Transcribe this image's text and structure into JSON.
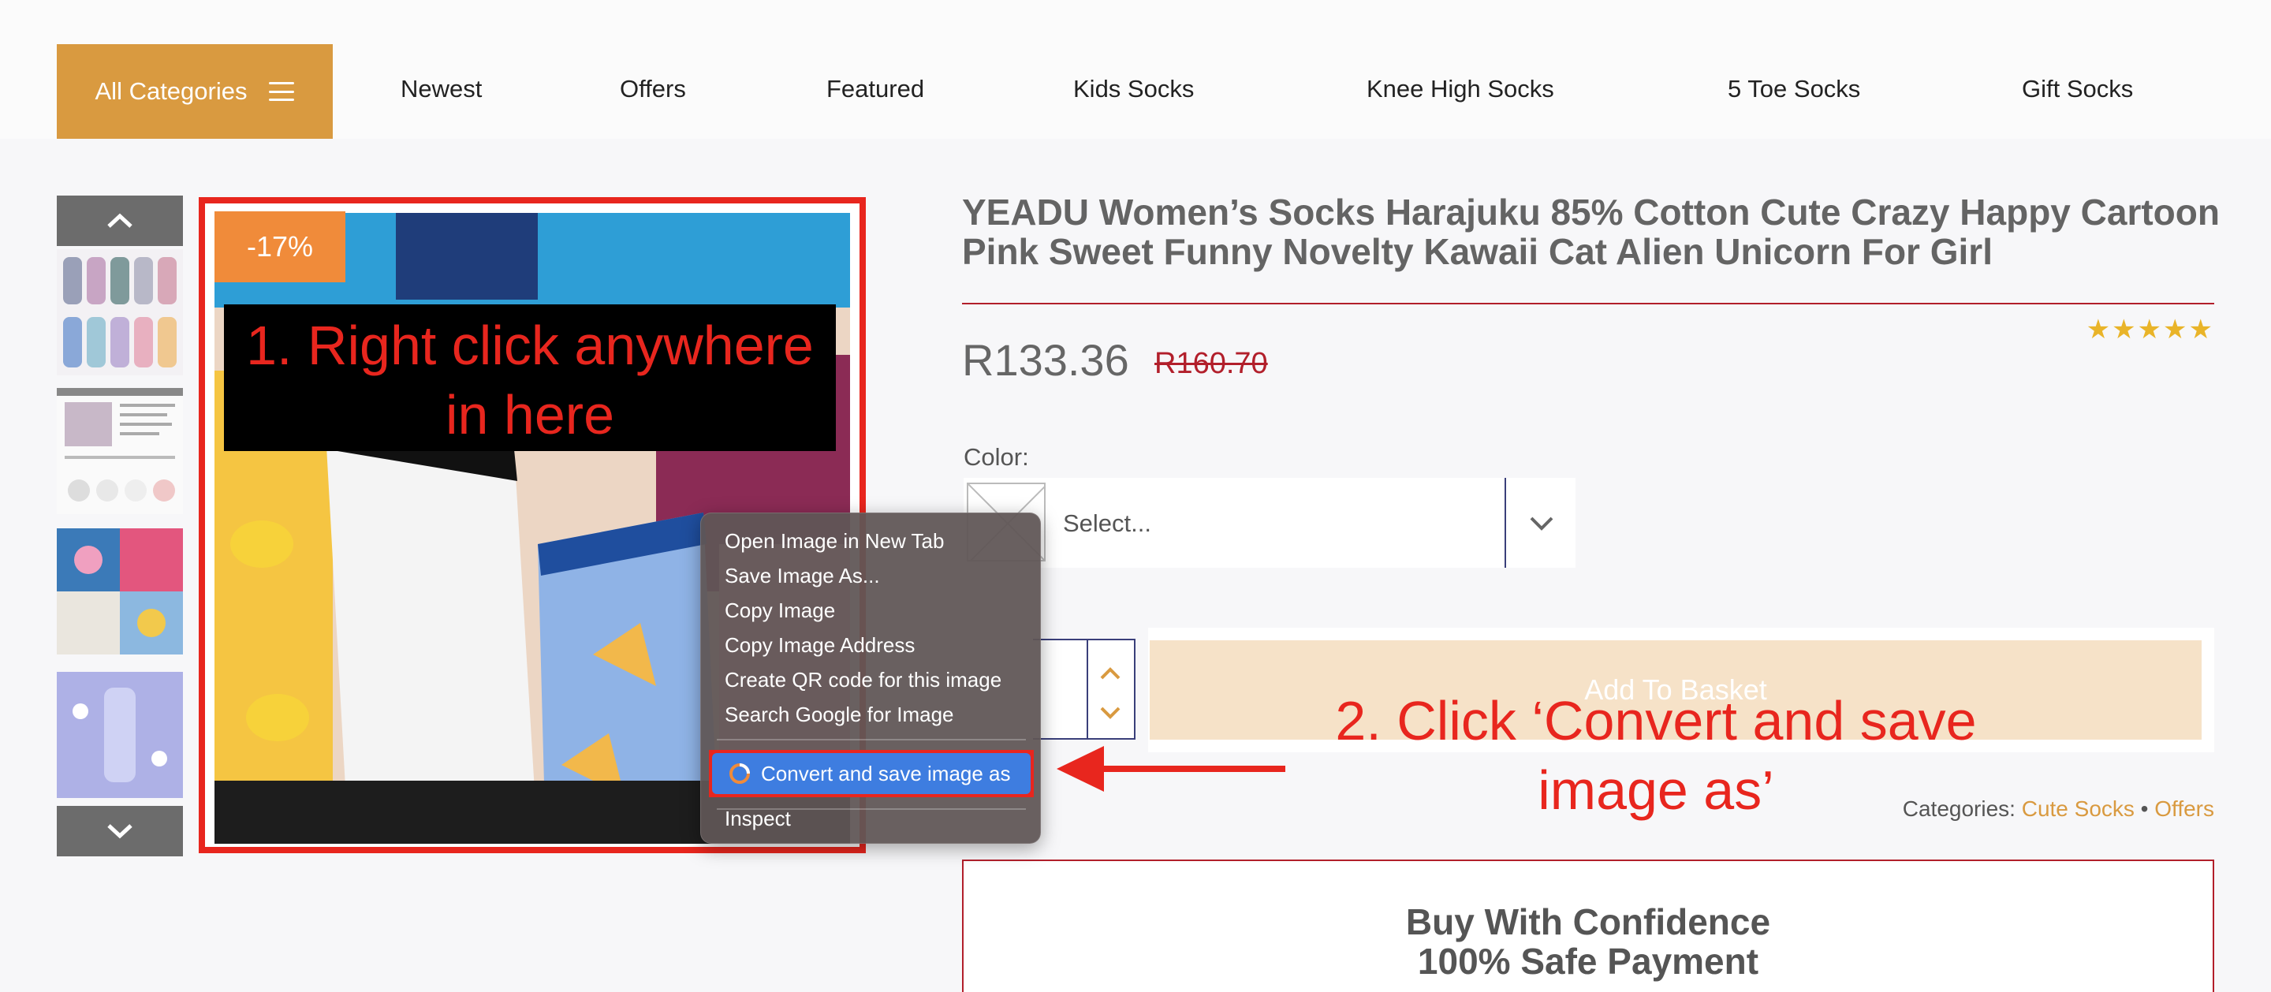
{
  "nav": {
    "all_categories": "All Categories",
    "items": [
      "Newest",
      "Offers",
      "Featured",
      "Kids Socks",
      "Knee High Socks",
      "5 Toe Socks",
      "Gift Socks"
    ]
  },
  "gallery": {
    "discount_badge": "-17%",
    "annotation_1": "1. Right click anywhere in here"
  },
  "product": {
    "title": "YEADU Women’s Socks Harajuku 85% Cotton Cute Crazy Happy Cartoon Pink Sweet Funny Novelty Kawaii Cat Alien Unicorn For Girl",
    "rating_stars": "★★★★★",
    "price": "R133.36",
    "old_price": "R160.70",
    "color_label": "Color:",
    "color_select_placeholder": "Select...",
    "add_to_basket": "Add To Basket",
    "categories_label": "Categories:",
    "categories": [
      "Cute Socks",
      "Offers"
    ],
    "categories_sep": "•",
    "confidence_line1": "Buy With Confidence",
    "confidence_line2": "100% Safe Payment"
  },
  "context_menu": {
    "items": [
      "Open Image in New Tab",
      "Save Image As...",
      "Copy Image",
      "Copy Image Address",
      "Create QR code for this image",
      "Search Google for Image"
    ],
    "highlighted_item": "Convert and save image as",
    "inspect": "Inspect"
  },
  "annotation_2": "2. Click ‘Convert and save image as’",
  "colors": {
    "accent_orange": "#d99a40",
    "annotation_red": "#e8261e",
    "menu_highlight_blue": "#3e7de0",
    "star_gold": "#e9b429"
  }
}
